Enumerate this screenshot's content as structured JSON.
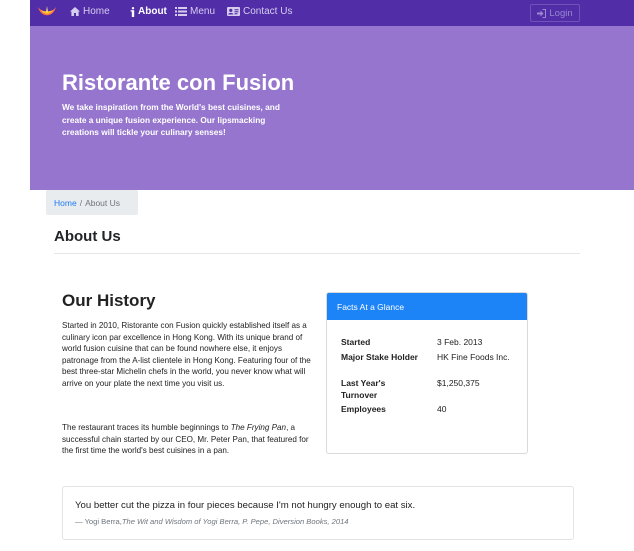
{
  "navbar": {
    "items": [
      {
        "label": "Home",
        "icon": "home-icon",
        "active": false
      },
      {
        "label": "About",
        "icon": "info-icon",
        "active": true
      },
      {
        "label": "Menu",
        "icon": "list-icon",
        "active": false
      },
      {
        "label": "Contact Us",
        "icon": "address-card-icon",
        "active": false
      }
    ],
    "login_label": "Login",
    "logo_icon": "restaurant-logo"
  },
  "jumbotron": {
    "title": "Ristorante con Fusion",
    "text": "We take inspiration from the World's best cuisines, and create a unique fusion experience. Our lipsmacking creations will tickle your culinary senses!"
  },
  "breadcrumb": {
    "home": "Home",
    "separator": "/",
    "current": "About Us"
  },
  "page_heading": "About Us",
  "history": {
    "title": "Our History",
    "paragraph1": "Started in 2010, Ristorante con Fusion quickly established itself as a culinary icon par excellence in Hong Kong. With its unique brand of world fusion cuisine that can be found nowhere else, it enjoys patronage from the A-list clientele in Hong Kong. Featuring four of the best three-star Michelin chefs in the world, you never know what will arrive on your plate the next time you visit us.",
    "paragraph2_before": "The restaurant traces its humble beginnings to ",
    "paragraph2_italic": "The Frying Pan",
    "paragraph2_after": ", a successful chain started by our CEO, Mr. Peter Pan, that featured for the first time the world's best cuisines in a pan."
  },
  "facts": {
    "header": "Facts At a Glance",
    "rows": [
      {
        "label": "Started",
        "value": "3 Feb. 2013"
      },
      {
        "label": "Major Stake Holder",
        "value": "HK Fine Foods Inc."
      },
      {
        "label": "Last Year's Turnover",
        "value": "$1,250,375"
      },
      {
        "label": "Employees",
        "value": "40"
      }
    ]
  },
  "quote": {
    "text": "You better cut the pizza in four pieces because I'm not hungry enough to eat six.",
    "author": "— Yogi Berra,",
    "source": "The Wit and Wisdom of Yogi Berra, P. Pepe, Diversion Books, 2014"
  },
  "colors": {
    "navbar": "#512da8",
    "jumbotron": "#9575cd",
    "card_header": "#1d84f7",
    "link": "#1e7bf5"
  }
}
